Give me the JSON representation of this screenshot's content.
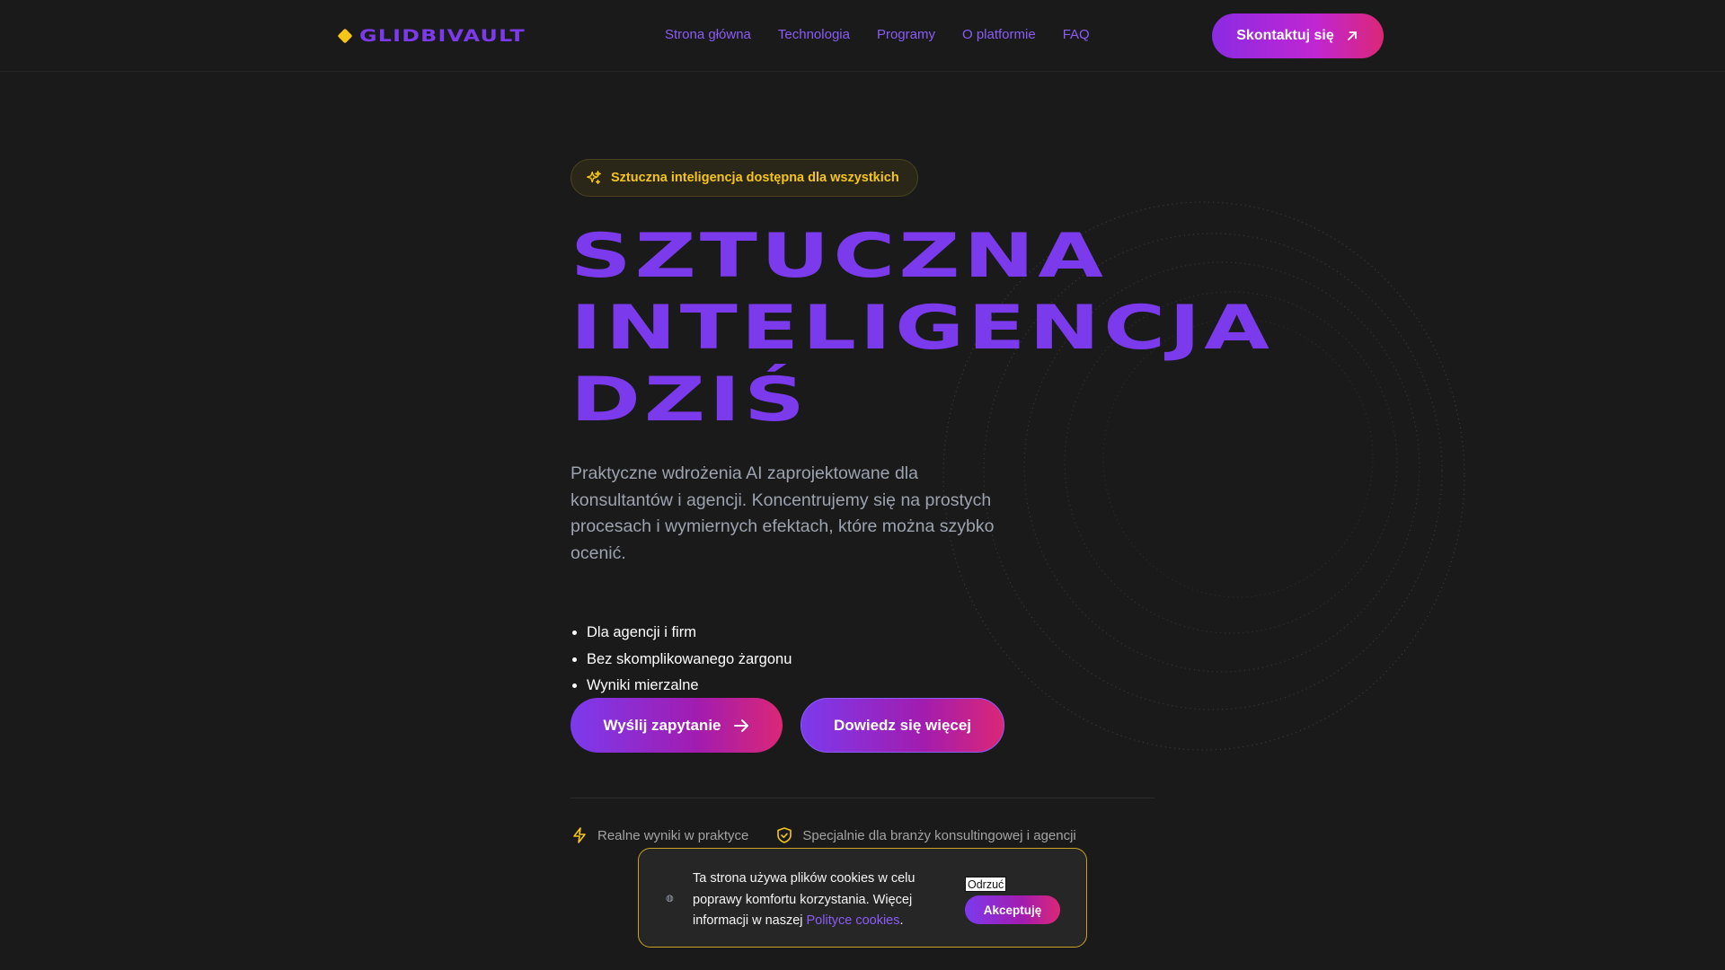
{
  "header": {
    "logo_text": "GLIDBIVAULT",
    "nav": [
      "Strona główna",
      "Technologia",
      "Programy",
      "O platformie",
      "FAQ"
    ],
    "contact_button": "Skontaktuj się"
  },
  "hero": {
    "badge": "Sztuczna inteligencja dostępna dla wszystkich",
    "headline_lines": [
      "SZTUCZNA",
      "INTELIGENCJA",
      "DZIŚ"
    ],
    "lead": "Praktyczne wdrożenia AI zaprojektowane dla konsultantów i agencji. Koncentrujemy się na prostych procesach i wymiernych efektach, które można szybko ocenić.",
    "bullets": [
      "Dla agencji i firm",
      "Bez skomplikowanego żargonu",
      "Wyniki mierzalne"
    ],
    "primary_button": "Wyślij zapytanie",
    "secondary_button": "Dowiedz się więcej",
    "features": [
      "Realne wyniki w praktyce",
      "Specjalnie dla branży konsultingowej i agencji"
    ]
  },
  "cookie_banner": {
    "text_before_link": "Ta strona używa plików cookies w celu poprawy komfortu korzystania. Więcej informacji w naszej ",
    "link_text": "Polityce cookies",
    "text_after_link": ".",
    "reject_button": "Odrzuć",
    "accept_button": "Akceptuję"
  },
  "colors": {
    "background": "#1a1a1a",
    "accent_purple": "#7c3aed",
    "accent_yellow": "#f5c518",
    "accent_pink": "#db2777"
  },
  "icons": {
    "logo": "diamond-icon",
    "contact": "arrow-up-right-icon",
    "badge": "sparkles-icon",
    "primary_button": "arrow-right-icon",
    "feature_1": "lightning-icon",
    "feature_2": "shield-check-icon",
    "cookie": "cookie-icon"
  }
}
